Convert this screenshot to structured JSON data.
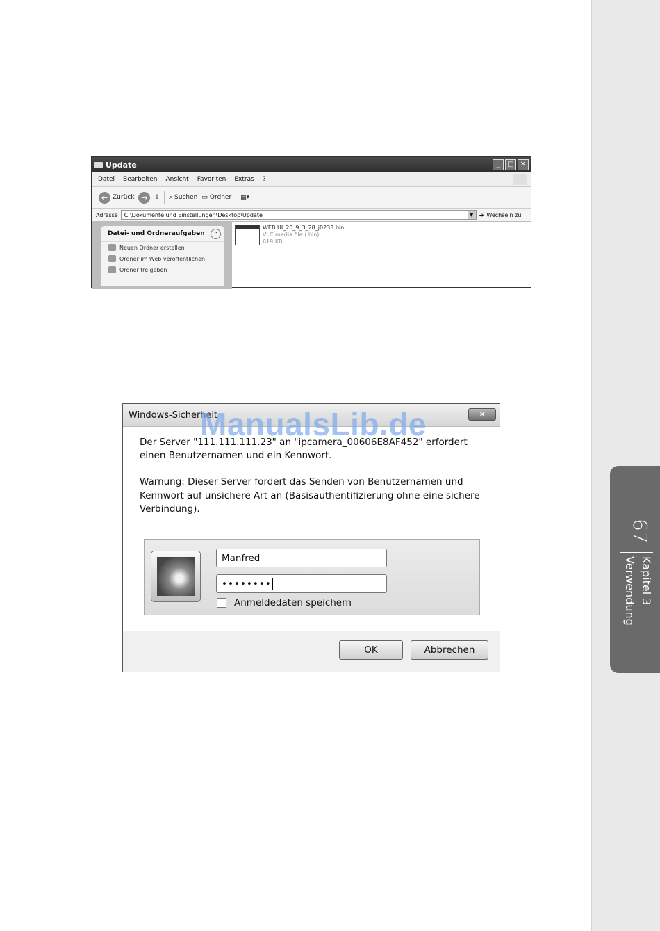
{
  "sidebar": {
    "page_number": "67",
    "chapter": "Kapitel 3",
    "section": "Verwendung"
  },
  "explorer": {
    "title": "Update",
    "menu": [
      "Datei",
      "Bearbeiten",
      "Ansicht",
      "Favoriten",
      "Extras",
      "?"
    ],
    "toolbar": {
      "back": "Zurück",
      "search": "Suchen",
      "folders": "Ordner"
    },
    "address_label": "Adresse",
    "address_value": "C:\\Dokumente und Einstellungen\\Desktop\\Update",
    "go_label": "Wechseln zu",
    "task_panel": {
      "title": "Datei- und Ordneraufgaben",
      "items": [
        "Neuen Ordner erstellen",
        "Ordner im Web veröffentlichen",
        "Ordner freigeben"
      ]
    },
    "file": {
      "name": "WEB UI_20_9_3_28_j0233.bin",
      "type": "VLC media file (.bin)",
      "size": "619 KB"
    }
  },
  "dialog": {
    "title": "Windows-Sicherheit",
    "message": "Der Server \"111.111.111.23\" an \"ipcamera_00606E8AF452\" erfordert einen Benutzernamen und ein Kennwort.",
    "warning": "Warnung: Dieser Server fordert das Senden von Benutzernamen und Kennwort auf unsichere Art an (Basisauthentifizierung ohne eine sichere Verbindung).",
    "username": "Manfred",
    "password_mask": "••••••••",
    "remember_label": "Anmeldedaten speichern",
    "ok_label": "OK",
    "cancel_label": "Abbrechen"
  },
  "watermark": "ManualsLib.de"
}
